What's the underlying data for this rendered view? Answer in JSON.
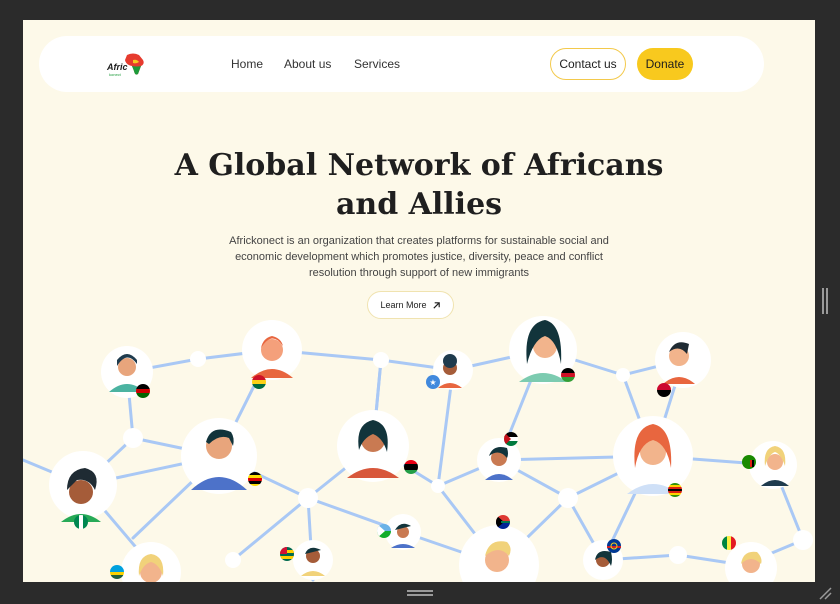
{
  "nav": {
    "logo_text": "Afric",
    "logo_sub": "konect",
    "links": [
      "Home",
      "About us",
      "Services"
    ],
    "contact_label": "Contact us",
    "donate_label": "Donate"
  },
  "hero": {
    "title_line1": "A Global Network of Africans",
    "title_line2": "and Allies",
    "description": "Africkonect is an organization that creates platforms for sustainable social and economic development which promotes justice, diversity, peace and conflict resolution through support of new immigrants",
    "learn_more_label": "Learn More",
    "learn_more_icon": "arrow-up-right-icon"
  },
  "colors": {
    "background": "#fdf9e9",
    "accent": "#f8c91e",
    "network_line": "#a9c8f5"
  }
}
